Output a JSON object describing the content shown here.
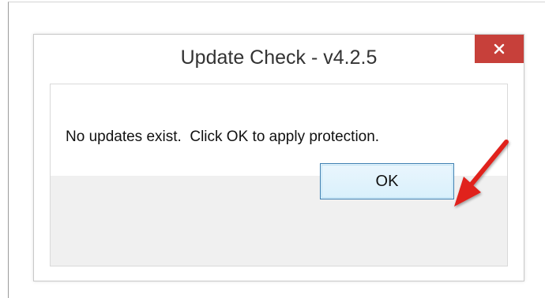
{
  "dialog": {
    "title": "Update Check - v4.2.5",
    "close_label": "×",
    "message": "No updates exist.  Click OK to apply protection.",
    "ok_label": "OK"
  },
  "annotation": {
    "arrow_color": "#e0201c",
    "icon": "red-arrow-icon"
  },
  "colors": {
    "close_button": "#c7403a",
    "ok_border": "#3c7fb1",
    "footer": "#f0f0f0"
  }
}
